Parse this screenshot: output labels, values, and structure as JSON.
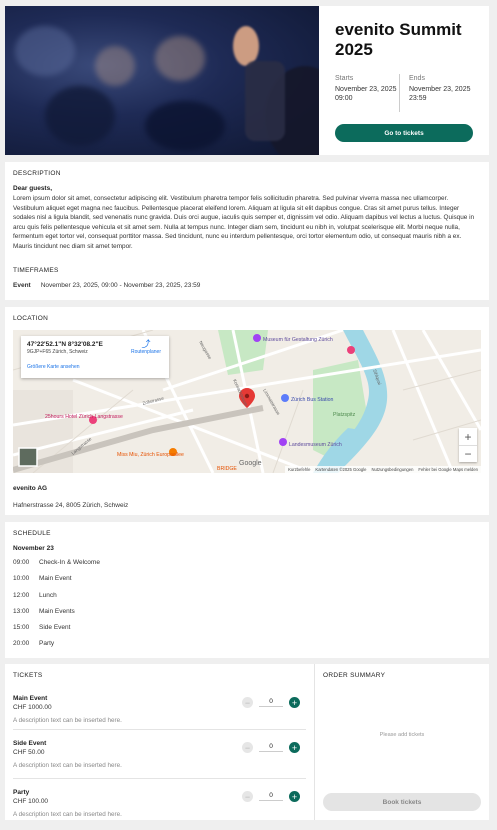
{
  "event": {
    "title": "evenito Summit 2025",
    "starts_label": "Starts",
    "starts_value": "November 23, 2025 09:00",
    "ends_label": "Ends",
    "ends_value": "November 23, 2025 23:59",
    "cta_label": "Go to tickets"
  },
  "description": {
    "title": "DESCRIPTION",
    "greeting": "Dear guests,",
    "body": "Lorem ipsum dolor sit amet, consectetur adipiscing elit. Vestibulum pharetra tempor felis sollicitudin pharetra. Sed pulvinar viverra massa nec ullamcorper. Vestibulum aliquet eget magna nec faucibus. Pellentesque placerat eleifend lorem. Aliquam at ligula sit elit dapibus congue. Cras sit amet purus tellus. Integer sodales nisl a ligula blandit, sed venenatis nunc gravida. Duis orci augue, iaculis quis semper et, dignissim vel odio. Aliquam dapibus vel lectus a luctus. Quisque in arcu quis felis pellentesque vehicula et sit amet sem. Nulla at tempus nunc. Integer diam sem, tincidunt eu nibh in, volutpat scelerisque elit. Morbi neque nulla, fermentum eget tortor vel, consequat porttitor massa. Sed tincidunt, nunc eu interdum pellentesque, orci tortor elementum odio, ut consequat mauris nibh a ex. Mauris tincidunt nec diam sit amet tempor."
  },
  "timeframes": {
    "title": "TIMEFRAMES",
    "label": "Event",
    "value": "November 23, 2025, 09:00 - November 23, 2025, 23:59"
  },
  "location": {
    "title": "LOCATION",
    "map": {
      "coords": "47°22'52.1\"N 8°32'08.2\"E",
      "plus_code": "9GJP+F65 Zürich, Schweiz",
      "larger_map": "Größere Karte ansehen",
      "route_planner": "Routenplaner",
      "zoom_in": "+",
      "zoom_out": "−",
      "attrib_shortcuts": "Kurzbefehle",
      "attrib_data": "Kartendaten ©2025 Google",
      "attrib_terms": "Nutzungsbedingungen",
      "attrib_report": "Fehler bei Google Maps melden",
      "google": "Google",
      "labels": [
        "Museum für Gestaltung Zürich",
        "Zürich Bus Station",
        "Platzspitz",
        "25hours Hotel Zürich Langstrasse",
        "Miss Miu, Zürich Europaallee",
        "Landesmuseum Zürich",
        "BRIDGE",
        "Limmatstrasse",
        "Konradstrasse",
        "Zollstrasse",
        "Sihlquai",
        "Langstrasse",
        "Neugasse"
      ]
    },
    "venue": "evenito AG",
    "address": "Hafnerstrasse 24, 8005 Zürich, Schweiz"
  },
  "schedule": {
    "title": "SCHEDULE",
    "day": "November 23",
    "items": [
      {
        "time": "09:00",
        "label": "Check-In & Welcome"
      },
      {
        "time": "10:00",
        "label": "Main Event"
      },
      {
        "time": "12:00",
        "label": "Lunch"
      },
      {
        "time": "13:00",
        "label": "Main Events"
      },
      {
        "time": "15:00",
        "label": "Side Event"
      },
      {
        "time": "20:00",
        "label": "Party"
      }
    ]
  },
  "tickets": {
    "title": "TICKETS",
    "items": [
      {
        "name": "Main Event",
        "price": "CHF 1000.00",
        "desc": "A description text can be inserted here.",
        "qty": "0"
      },
      {
        "name": "Side Event",
        "price": "CHF 50.00",
        "desc": "A description text can be inserted here.",
        "qty": "0"
      },
      {
        "name": "Party",
        "price": "CHF 100.00",
        "desc": "A description text can be inserted here.",
        "qty": "0"
      }
    ]
  },
  "order_summary": {
    "title": "ORDER SUMMARY",
    "empty_text": "Please add tickets",
    "book_label": "Book tickets"
  },
  "colors": {
    "accent": "#0c6b5c",
    "map_water": "#9fd7e6",
    "map_park": "#c7e8c4"
  }
}
